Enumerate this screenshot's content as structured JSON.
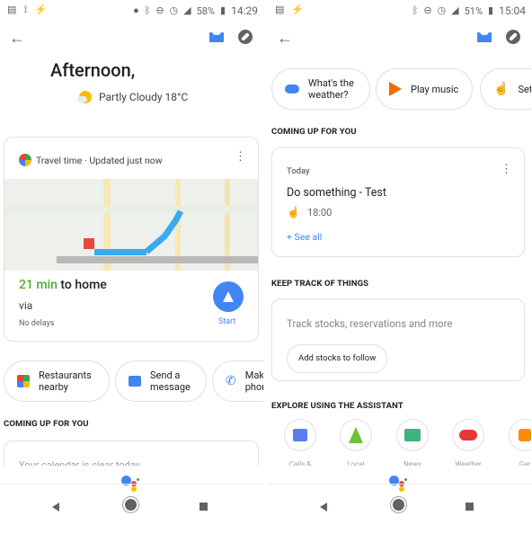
{
  "left": {
    "status": {
      "battery": "58%",
      "time": "14:29",
      "icons_left": [
        "notes-icon",
        "signal-broadcast-icon",
        "flash-icon"
      ],
      "icons_right": [
        "location-icon",
        "bluetooth-icon",
        "dnd-icon",
        "alarm-icon",
        "lte-signal-icon",
        "battery-icon"
      ]
    },
    "greeting": "Afternoon,",
    "weather": "Partly Cloudy 18°C",
    "travel_card": {
      "header": "Travel time · Updated just now",
      "duration": "21 min",
      "destination": " to home",
      "via": "via",
      "delays": "No delays",
      "start_label": "Start"
    },
    "chips": [
      {
        "label": "Restaurants nearby",
        "l1": "Restaurants",
        "l2": "nearby"
      },
      {
        "label": "Send a message",
        "l1": "Send a",
        "l2": "message"
      },
      {
        "label": "Make phone call",
        "l1": "Mak",
        "l2": "phon"
      }
    ],
    "coming_up_title": "COMING UP FOR YOU",
    "calendar_text": "Your calendar is clear today"
  },
  "right": {
    "status": {
      "battery": "51%",
      "time": "15:04"
    },
    "chips": [
      {
        "l1": "What's the",
        "l2": "weather?"
      },
      {
        "l1": "Play music",
        "l2": ""
      },
      {
        "l1": "Set a",
        "l2": ""
      }
    ],
    "coming_up_title": "COMING UP FOR YOU",
    "reminder_card": {
      "day": "Today",
      "title": "Do something - Test",
      "time": "18:00",
      "see_all": "+ See all"
    },
    "keep_track_title": "KEEP TRACK OF THINGS",
    "keep_track_card": {
      "text": "Track stocks, reservations and more",
      "button": "Add stocks to follow"
    },
    "explore_title": "EXPLORE USING THE ASSISTANT",
    "explore_items": [
      "Calls &",
      "Local",
      "News",
      "Weather",
      "Gar"
    ]
  },
  "colors": {
    "accent": "#4285f4",
    "green": "#34a853",
    "link": "#4285f4"
  }
}
